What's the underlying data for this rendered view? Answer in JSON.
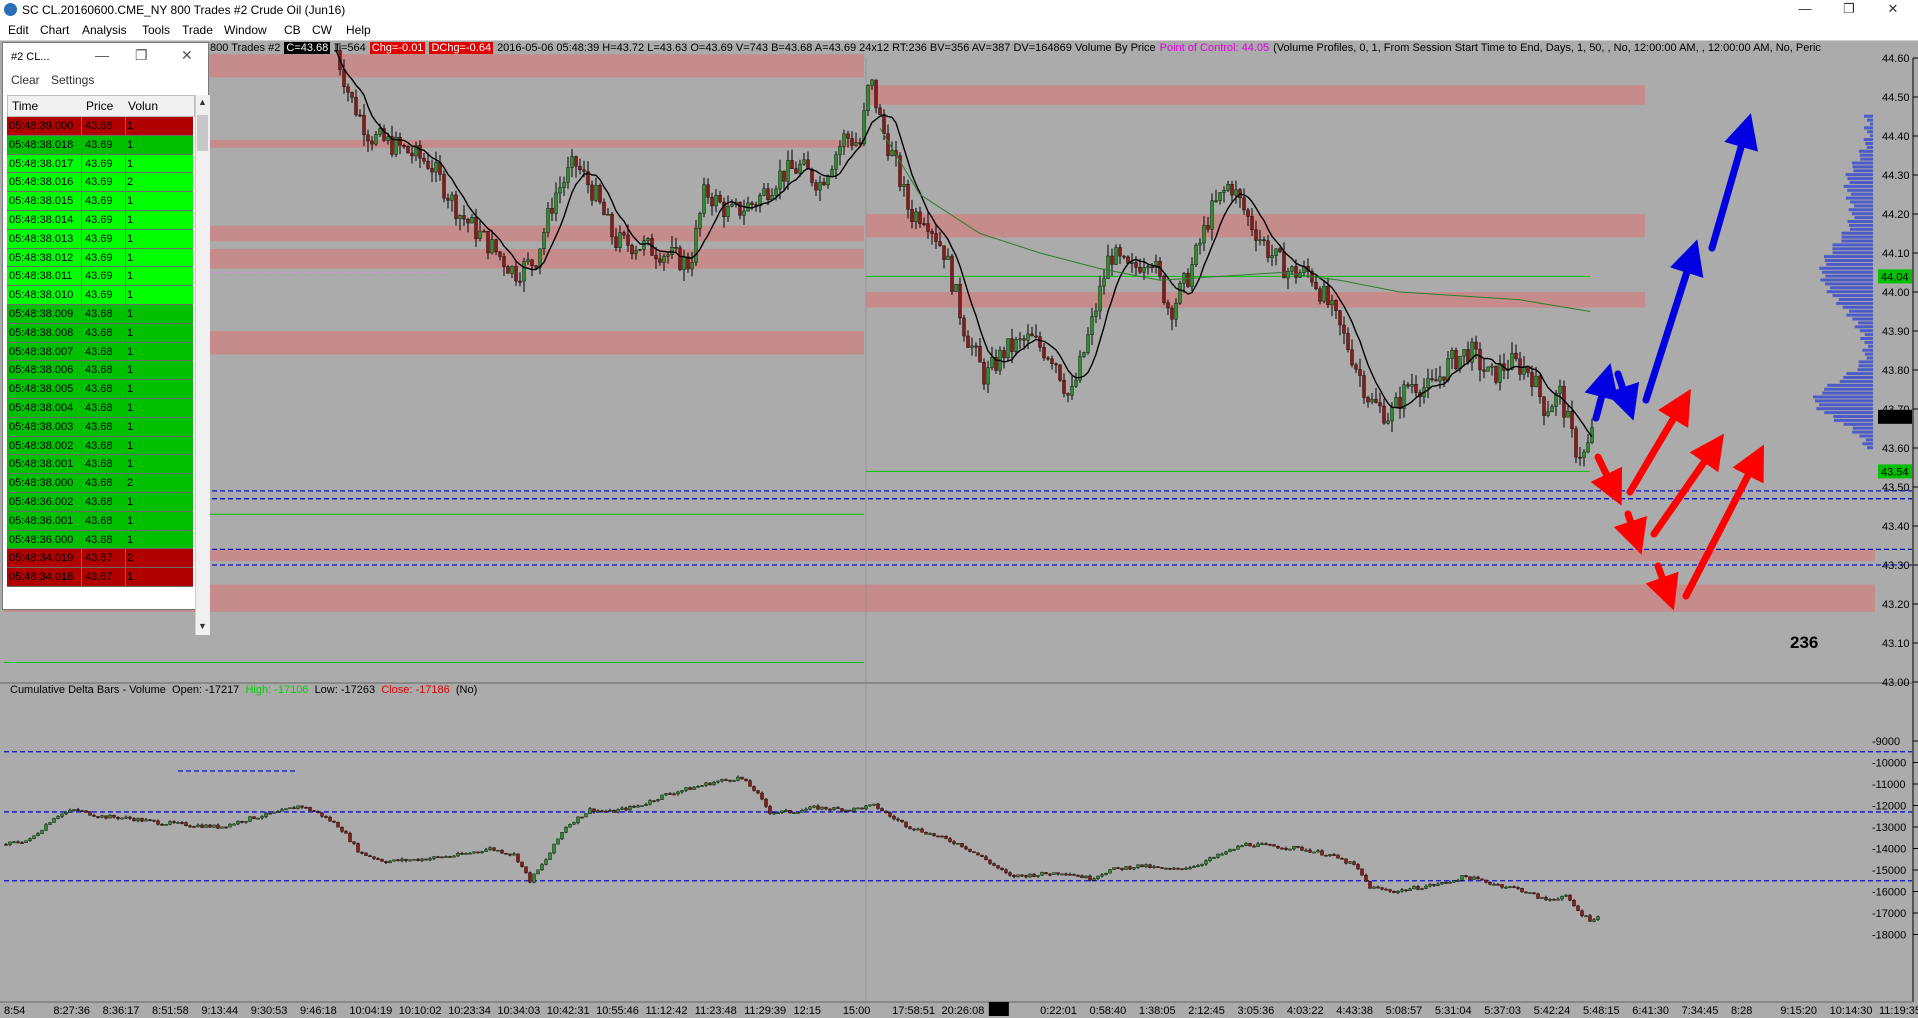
{
  "window": {
    "title": "SC CL.20160600.CME_NY  800 Trades  #2  Crude Oil (Jun16)",
    "buttons": [
      "—",
      "❐",
      "✕"
    ]
  },
  "menu": [
    "Edit",
    "Chart",
    "Analysis",
    "Tools",
    "Trade",
    "Window",
    "CB",
    "CW",
    "Help"
  ],
  "infobar": {
    "prefix": "800 Trades  #2",
    "c": "C=43.68",
    "t": "T=564",
    "chg": "Chg=-0.01",
    "dchg": "DChg=-0.64",
    "stats": "2016-05-06  05:48:39  H=43.72  L=43.63  O=43.69  V=743  B=43.68  A=43.69  24x12  RT:236  BV=356  AV=387  DV=164869  Volume By Price",
    "poc": "Point of Control: 44.05",
    "profile": "(Volume Profiles, 0, 1, From Session Start Time to End, Days, 1, 50, , No, 12:00:00 AM, , 12:00:00 AM, No, Peric"
  },
  "lower_study": {
    "name": "Cumulative Delta Bars - Volume",
    "open": "Open: -17217",
    "high": "High: -17106",
    "low": "Low: -17263",
    "close": "Close: -17186",
    "flag": "(No)"
  },
  "bar_countdown": "236",
  "time_and_sales": {
    "title": "#2  CL...",
    "controls": [
      "—",
      "❐",
      "✕"
    ],
    "toolbar": [
      "Clear",
      "Settings"
    ],
    "columns": [
      "Time",
      "Price",
      "Volun"
    ],
    "rows": [
      {
        "time": "05:48:39.000",
        "price": "43.68",
        "vol": "1",
        "color": "#b00000"
      },
      {
        "time": "05:48:38.018",
        "price": "43.69",
        "vol": "1",
        "color": "#00c000"
      },
      {
        "time": "05:48:38.017",
        "price": "43.69",
        "vol": "1",
        "color": "#00ff00"
      },
      {
        "time": "05:48:38.016",
        "price": "43.69",
        "vol": "2",
        "color": "#00ff00"
      },
      {
        "time": "05:48:38.015",
        "price": "43.69",
        "vol": "1",
        "color": "#00ff00"
      },
      {
        "time": "05:48:38.014",
        "price": "43.69",
        "vol": "1",
        "color": "#00ff00"
      },
      {
        "time": "05:48:38.013",
        "price": "43.69",
        "vol": "1",
        "color": "#00ff00"
      },
      {
        "time": "05:48:38.012",
        "price": "43.69",
        "vol": "1",
        "color": "#00ff00"
      },
      {
        "time": "05:48:38.011",
        "price": "43.69",
        "vol": "1",
        "color": "#00ff00"
      },
      {
        "time": "05:48:38.010",
        "price": "43.69",
        "vol": "1",
        "color": "#00ff00"
      },
      {
        "time": "05:48:38.009",
        "price": "43.68",
        "vol": "1",
        "color": "#00c000"
      },
      {
        "time": "05:48:38.008",
        "price": "43.68",
        "vol": "1",
        "color": "#00c000"
      },
      {
        "time": "05:48:38.007",
        "price": "43.68",
        "vol": "1",
        "color": "#00c000"
      },
      {
        "time": "05:48:38.006",
        "price": "43.68",
        "vol": "1",
        "color": "#00c000"
      },
      {
        "time": "05:48:38.005",
        "price": "43.68",
        "vol": "1",
        "color": "#00c000"
      },
      {
        "time": "05:48:38.004",
        "price": "43.68",
        "vol": "1",
        "color": "#00c000"
      },
      {
        "time": "05:48:38.003",
        "price": "43.68",
        "vol": "1",
        "color": "#00c000"
      },
      {
        "time": "05:48:38.002",
        "price": "43.68",
        "vol": "1",
        "color": "#00c000"
      },
      {
        "time": "05:48:38.001",
        "price": "43.68",
        "vol": "1",
        "color": "#00c000"
      },
      {
        "time": "05:48:38.000",
        "price": "43.68",
        "vol": "2",
        "color": "#00c000"
      },
      {
        "time": "05:48:36.002",
        "price": "43.68",
        "vol": "1",
        "color": "#00c000"
      },
      {
        "time": "05:48:36.001",
        "price": "43.68",
        "vol": "1",
        "color": "#00c000"
      },
      {
        "time": "05:48:36.000",
        "price": "43.68",
        "vol": "1",
        "color": "#00c000"
      },
      {
        "time": "05:48:34.019",
        "price": "43.67",
        "vol": "2",
        "color": "#b00000"
      },
      {
        "time": "05:48:34.018",
        "price": "43.67",
        "vol": "1",
        "color": "#b00000"
      }
    ]
  },
  "price_axis": {
    "ticks": [
      "44.60",
      "44.50",
      "44.40",
      "44.30",
      "44.20",
      "44.10",
      "44.00",
      "43.90",
      "43.80",
      "43.70",
      "43.60",
      "43.50",
      "43.40",
      "43.30",
      "43.20",
      "43.10",
      "43.00"
    ],
    "markers": [
      {
        "label": "44.04",
        "price": 44.04,
        "bg": "#00c000",
        "fg": "#ffffff"
      },
      {
        "label": "43.68",
        "price": 43.68,
        "bg": "#000000",
        "fg": "#ffffff"
      },
      {
        "label": "43.54",
        "price": 43.54,
        "bg": "#00c000",
        "fg": "#ffffff"
      }
    ]
  },
  "delta_axis": {
    "ticks": [
      "-9000",
      "-10000",
      "-11000",
      "-12000",
      "-13000",
      "-14000",
      "-15000",
      "-16000",
      "-17000",
      "-18000"
    ]
  },
  "time_axis": {
    "labels": [
      "8:54",
      "8:27:36",
      "8:36:17",
      "8:51:58",
      "9:13:44",
      "9:30:53",
      "9:46:18",
      "10:04:19",
      "10:10:02",
      "10:23:34",
      "10:34:03",
      "10:42:31",
      "10:55:46",
      "11:12:42",
      "11:23:48",
      "11:29:39",
      "12:15",
      "15:00",
      "17:58:51",
      "20:26:08",
      "5-6",
      "0:22:01",
      "0:58:40",
      "1:38:05",
      "2:12:45",
      "3:05:36",
      "4:03:22",
      "4:43:38",
      "5:08:57",
      "5:31:04",
      "5:37:03",
      "5:42:24",
      "5:48:15",
      "6:41:30",
      "7:34:45",
      "8:28",
      "9:15:20",
      "10:14:30",
      "11:19:35"
    ]
  },
  "chart_data": {
    "type": "candlestick",
    "price_range": [
      43.0,
      44.6
    ],
    "delta_range": [
      -18000,
      -9000
    ],
    "volume_zones": [
      {
        "price_low": 44.55,
        "price_high": 44.61,
        "span": "session1"
      },
      {
        "price_low": 44.48,
        "price_high": 44.53,
        "span": "session2"
      },
      {
        "price_low": 44.37,
        "price_high": 44.39,
        "span": "session1"
      },
      {
        "price_low": 44.14,
        "price_high": 44.2,
        "span": "session2"
      },
      {
        "price_low": 44.13,
        "price_high": 44.17,
        "span": "session1"
      },
      {
        "price_low": 44.06,
        "price_high": 44.11,
        "span": "session1"
      },
      {
        "price_low": 43.96,
        "price_high": 44.0,
        "span": "session2"
      },
      {
        "price_low": 43.84,
        "price_high": 43.9,
        "span": "session1"
      },
      {
        "price_low": 43.31,
        "price_high": 43.34,
        "span": "full"
      },
      {
        "price_low": 43.18,
        "price_high": 43.25,
        "span": "full"
      }
    ],
    "blue_dashed_levels_price": [
      43.49,
      43.47,
      43.34,
      43.3
    ],
    "blue_dashed_levels_delta": [
      -9500,
      -12300,
      -15500
    ],
    "current_price": 43.68
  }
}
